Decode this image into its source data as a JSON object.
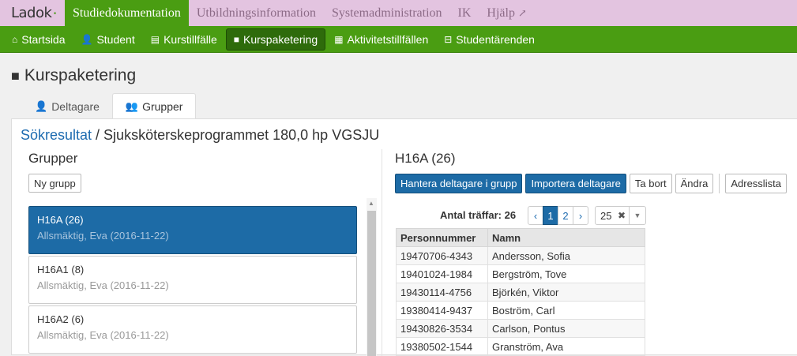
{
  "app": {
    "logo": "Ladok",
    "top_nav": [
      "Studiedokumentation",
      "Utbildningsinformation",
      "Systemadministration",
      "IK",
      "Hjälp"
    ]
  },
  "sub_nav": [
    {
      "label": "Startsida",
      "icon": "home-icon",
      "glyph": "⌂"
    },
    {
      "label": "Student",
      "icon": "user-icon",
      "glyph": "👤"
    },
    {
      "label": "Kurstillfälle",
      "icon": "book-icon",
      "glyph": "▤"
    },
    {
      "label": "Kurspaketering",
      "icon": "folder-icon",
      "glyph": "■"
    },
    {
      "label": "Aktivitetstillfällen",
      "icon": "calendar-icon",
      "glyph": "▦"
    },
    {
      "label": "Studentärenden",
      "icon": "inbox-icon",
      "glyph": "⊟"
    }
  ],
  "page": {
    "title": "Kurspaketering",
    "tabs": [
      "Deltagare",
      "Grupper"
    ],
    "breadcrumb_link": "Sökresultat",
    "breadcrumb_rest": " / Sjuksköterskeprogrammet 180,0 hp VGSJU"
  },
  "groups_panel": {
    "heading": "Grupper",
    "new_group_label": "Ny grupp",
    "groups": [
      {
        "name": "H16A (26)",
        "created": "Allsmäktig, Eva (2016-11-22)"
      },
      {
        "name": "H16A1 (8)",
        "created": "Allsmäktig, Eva (2016-11-22)"
      },
      {
        "name": "H16A2 (6)",
        "created": "Allsmäktig, Eva (2016-11-22)"
      }
    ]
  },
  "detail_panel": {
    "heading": "H16A (26)",
    "actions": {
      "manage": "Hantera deltagare i grupp",
      "import": "Importera deltagare",
      "delete": "Ta bort",
      "edit": "Ändra",
      "address_list": "Adresslista"
    },
    "hits_label": "Antal träffar: 26",
    "pager": {
      "prev": "‹",
      "pages": [
        "1",
        "2"
      ],
      "next": "›",
      "current": "1"
    },
    "page_size": "25",
    "table": {
      "columns": [
        "Personnummer",
        "Namn"
      ],
      "rows": [
        [
          "19470706-4343",
          "Andersson, Sofia"
        ],
        [
          "19401024-1984",
          "Bergström, Tove"
        ],
        [
          "19430114-4756",
          "Björkén, Viktor"
        ],
        [
          "19380414-9437",
          "Boström, Carl"
        ],
        [
          "19430826-3534",
          "Carlson, Pontus"
        ],
        [
          "19380502-1544",
          "Granström, Ava"
        ]
      ]
    }
  },
  "colors": {
    "top_bar": "#e3c4e0",
    "nav_green": "#4a9d12",
    "primary_blue": "#1d6ba6"
  }
}
